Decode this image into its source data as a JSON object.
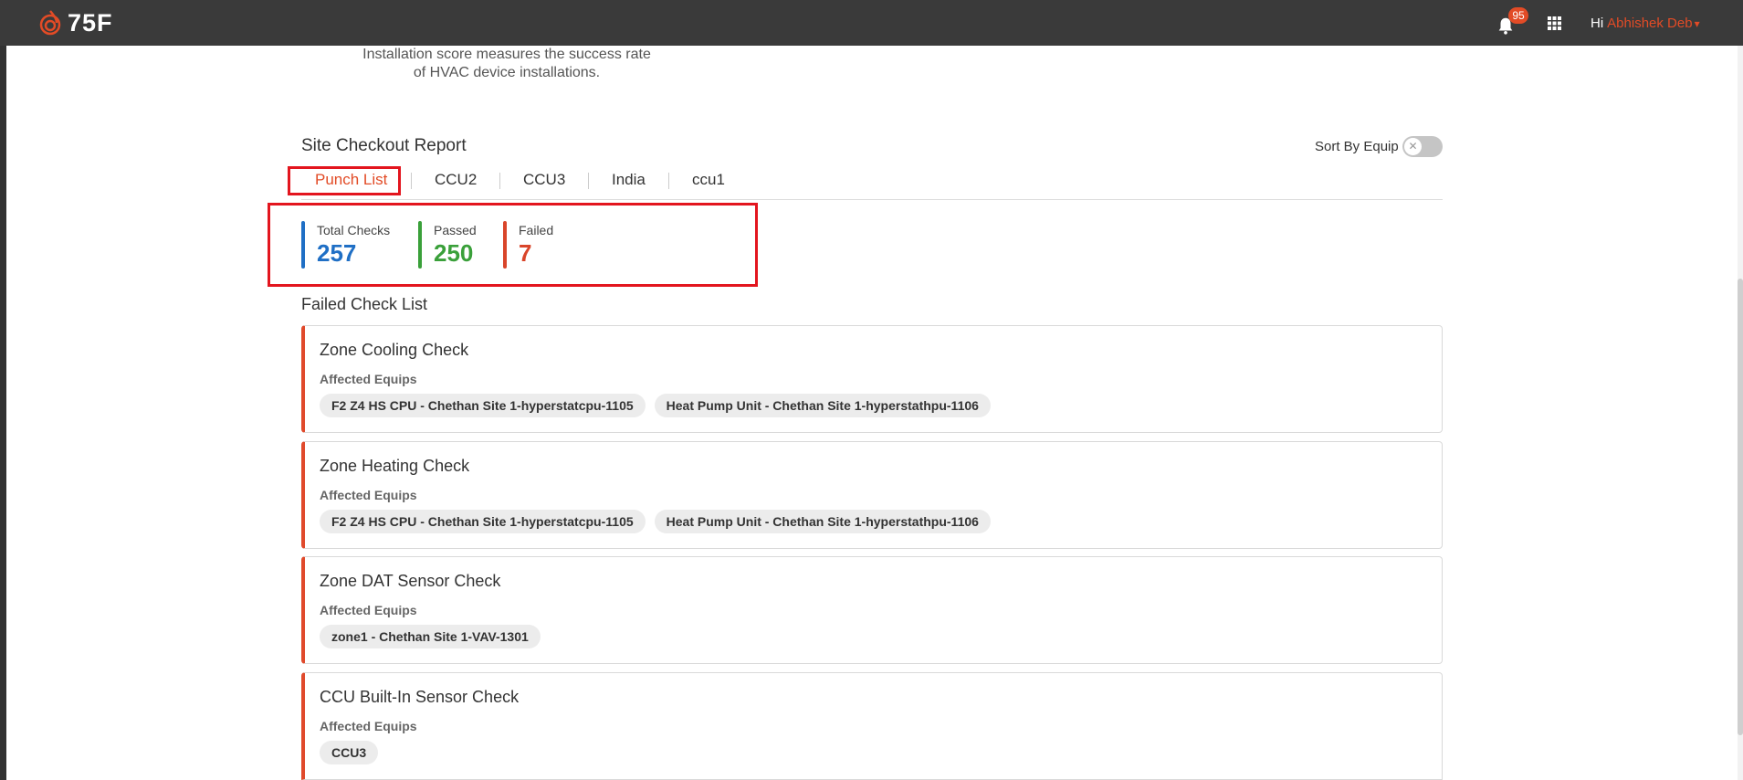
{
  "header": {
    "logo_text": "75F",
    "notification_count": "95",
    "greeting": "Hi",
    "user_name": "Abhishek Deb"
  },
  "score": {
    "description_line1": "Installation score measures the success rate",
    "description_line2": "of HVAC device installations."
  },
  "report": {
    "title": "Site Checkout Report",
    "sort_label": "Sort By Equip",
    "sort_enabled": false,
    "tabs": [
      {
        "label": "Punch List",
        "active": true
      },
      {
        "label": "CCU2",
        "active": false
      },
      {
        "label": "CCU3",
        "active": false
      },
      {
        "label": "India",
        "active": false
      },
      {
        "label": "ccu1",
        "active": false
      }
    ]
  },
  "stats": {
    "total": {
      "label": "Total Checks",
      "value": "257",
      "color": "#1f6fc5"
    },
    "passed": {
      "label": "Passed",
      "value": "250",
      "color": "#3aa03a"
    },
    "failed": {
      "label": "Failed",
      "value": "7",
      "color": "#d9452a"
    }
  },
  "failed_list": {
    "title": "Failed Check List",
    "affected_label": "Affected Equips",
    "items": [
      {
        "title": "Zone Cooling Check",
        "equips": [
          "F2 Z4 HS CPU - Chethan Site 1-hyperstatcpu-1105",
          "Heat Pump Unit - Chethan Site 1-hyperstathpu-1106"
        ]
      },
      {
        "title": "Zone Heating Check",
        "equips": [
          "F2 Z4 HS CPU - Chethan Site 1-hyperstatcpu-1105",
          "Heat Pump Unit - Chethan Site 1-hyperstathpu-1106"
        ]
      },
      {
        "title": "Zone DAT Sensor Check",
        "equips": [
          "zone1 - Chethan Site 1-VAV-1301"
        ]
      },
      {
        "title": "CCU Built-In Sensor Check",
        "equips": [
          "CCU3"
        ]
      }
    ]
  },
  "colors": {
    "accent": "#e24b26",
    "topbar": "#3a3a3a",
    "highlight_box": "#e3151e"
  }
}
